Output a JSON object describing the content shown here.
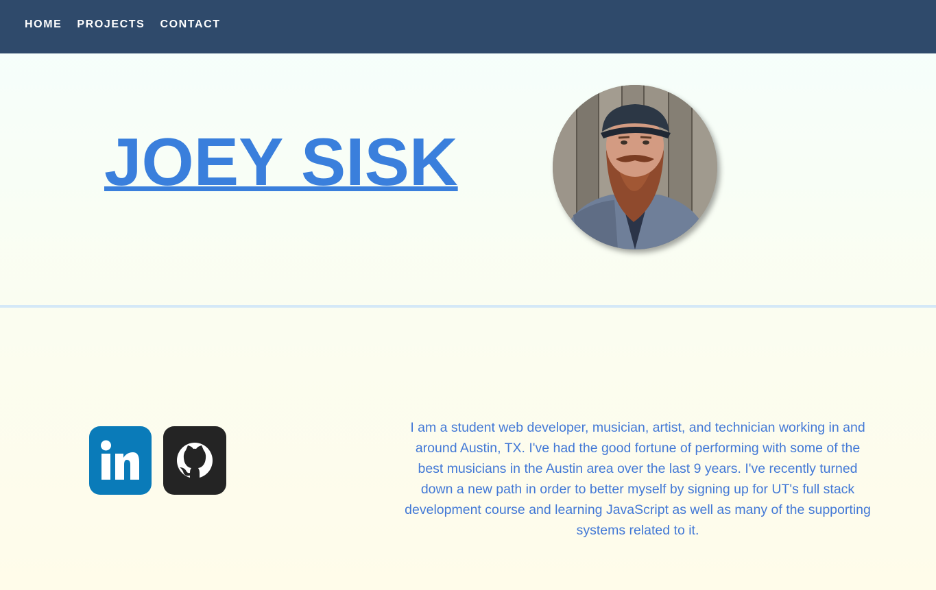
{
  "nav": {
    "links": [
      {
        "label": "HOME"
      },
      {
        "label": "PROJECTS"
      },
      {
        "label": "CONTACT"
      }
    ],
    "background": "#2f4a6b"
  },
  "hero": {
    "name": "JOEY SISK",
    "name_color": "#3a7fdc",
    "avatar_icon": "profile-photo"
  },
  "social": {
    "links": [
      {
        "name": "linkedin-icon",
        "color": "#0a7bb9"
      },
      {
        "name": "github-icon",
        "color": "#242424"
      }
    ]
  },
  "about": {
    "text": "I am a student web developer, musician, artist, and technician working in and around Austin, TX. I've had the good fortune of performing with some of the best musicians in the Austin area over the last 9 years. I've recently turned down a new path in order to better myself by signing up for UT's full stack development course and learning JavaScript as well as many of the supporting systems related to it.",
    "color": "#4278d6"
  }
}
